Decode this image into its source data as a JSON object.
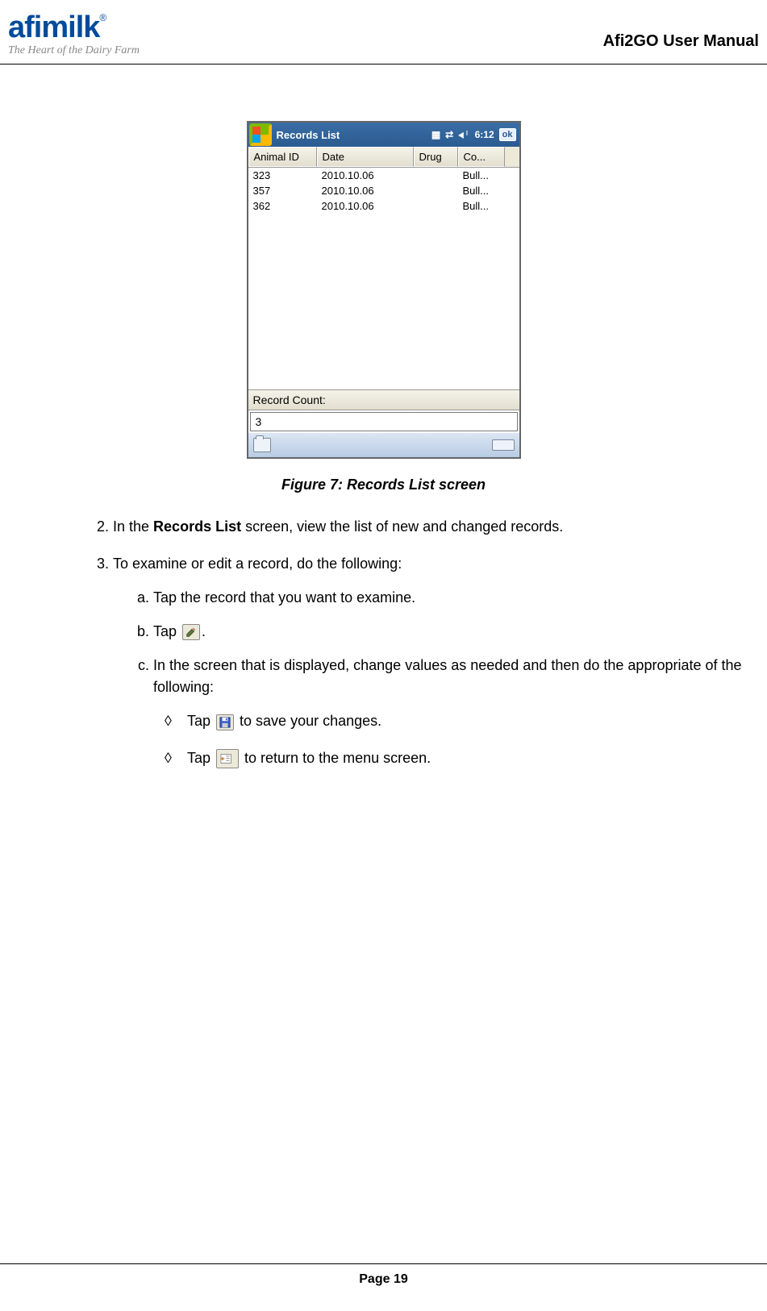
{
  "header": {
    "logo_text": "afimilk",
    "logo_reg": "®",
    "tagline": "The Heart of the Dairy Farm",
    "doc_title": "Afi2GO User Manual"
  },
  "pda": {
    "title": "Records List",
    "time": "6:12",
    "ok": "ok",
    "columns": {
      "id": "Animal ID",
      "date": "Date",
      "drug": "Drug",
      "co": "Co..."
    },
    "rows": [
      {
        "id": "323",
        "date": "2010.10.06",
        "drug": "",
        "co": "Bull..."
      },
      {
        "id": "357",
        "date": "2010.10.06",
        "drug": "",
        "co": "Bull..."
      },
      {
        "id": "362",
        "date": "2010.10.06",
        "drug": "",
        "co": "Bull..."
      }
    ],
    "count_label": "Record Count:",
    "count_value": "3"
  },
  "figure_caption": "Figure 7: Records List screen",
  "steps": {
    "s2_a": "In the ",
    "s2_b": "Records List",
    "s2_c": " screen, view the list of new and changed records.",
    "s3": "To examine or edit a record, do the following:",
    "s3a": "Tap the record that you want to examine.",
    "s3b_a": "Tap ",
    "s3b_b": ".",
    "s3c": "In the screen that is displayed, change values as needed and then do the appropriate of the following:",
    "d1_a": "Tap ",
    "d1_b": " to save your changes.",
    "d2_a": "Tap ",
    "d2_b": " to return to the menu screen."
  },
  "footer": {
    "page": "Page 19"
  }
}
